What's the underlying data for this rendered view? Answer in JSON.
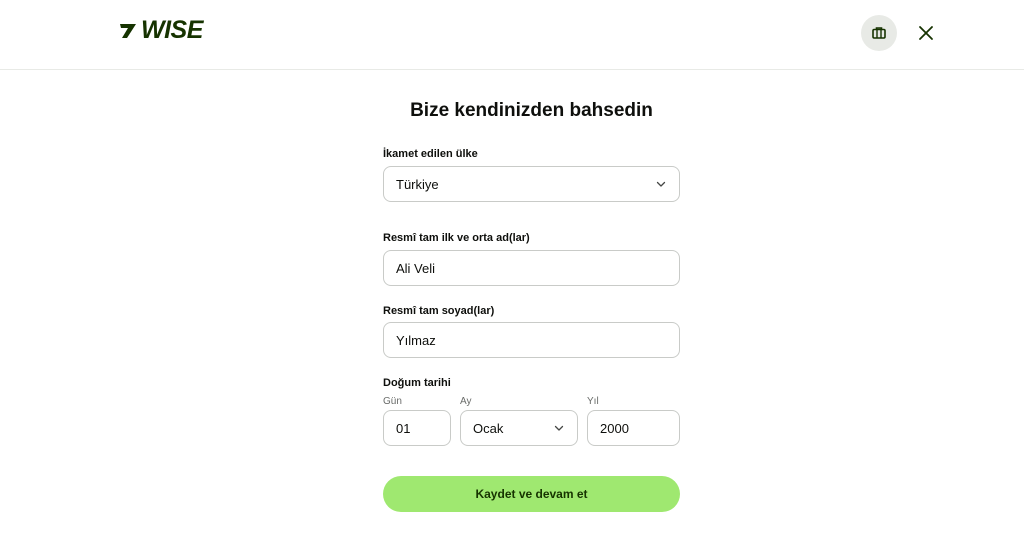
{
  "header": {
    "logo_text": "WISE",
    "help_icon": "briefcase-icon",
    "close_icon": "close-icon"
  },
  "page": {
    "title": "Bize kendinizden bahsedin"
  },
  "form": {
    "country": {
      "label": "İkamet edilen ülke",
      "value": "Türkiye"
    },
    "first_name": {
      "label": "Resmî tam ilk ve orta ad(lar)",
      "value": "Ali Veli"
    },
    "last_name": {
      "label": "Resmî tam soyad(lar)",
      "value": "Yılmaz"
    },
    "dob": {
      "label": "Doğum tarihi",
      "day": {
        "label": "Gün",
        "value": "01"
      },
      "month": {
        "label": "Ay",
        "value": "Ocak"
      },
      "year": {
        "label": "Yıl",
        "value": "2000"
      }
    },
    "submit_label": "Kaydet ve devam et"
  },
  "colors": {
    "brand_green": "#163300",
    "accent_green": "#9fe870",
    "border": "#c9cbc8"
  }
}
